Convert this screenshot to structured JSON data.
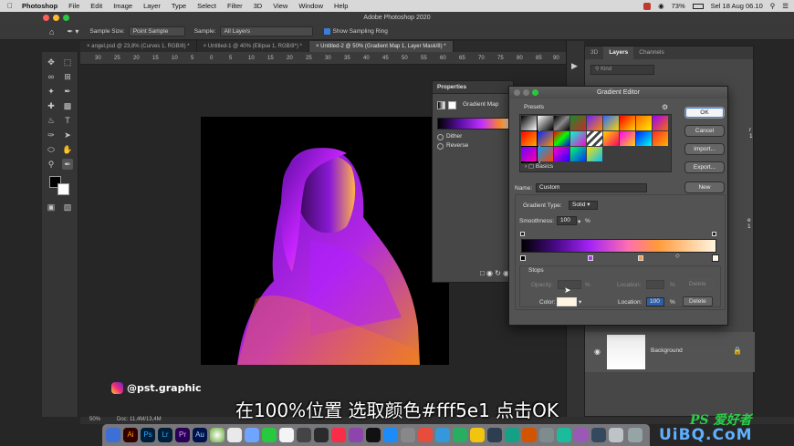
{
  "menubar": {
    "app": "Photoshop",
    "items": [
      "File",
      "Edit",
      "Image",
      "Layer",
      "Type",
      "Select",
      "Filter",
      "3D",
      "View",
      "Window",
      "Help"
    ],
    "battery": "73%",
    "clock": "Sel 18 Aug  06.10"
  },
  "window": {
    "title": "Adobe Photoshop 2020"
  },
  "options": {
    "sample_size_label": "Sample Size:",
    "sample_size_value": "Point Sample",
    "sample_label": "Sample:",
    "sample_value": "All Layers",
    "show_ring_label": "Show Sampling Ring"
  },
  "tabs": [
    {
      "label": "angel.psd @ 23,8% (Curves 1, RGB/8) *"
    },
    {
      "label": "Untitled-1 @ 40% (Ellipse 1, RGB/8*) *"
    },
    {
      "label": "Untitled-2 @ 50% (Gradient Map 1, Layer Mask/8) *"
    }
  ],
  "ruler": [
    "30",
    "25",
    "20",
    "15",
    "10",
    "5",
    "0",
    "5",
    "10",
    "15",
    "20",
    "25",
    "30",
    "35",
    "40",
    "45",
    "50",
    "55",
    "60",
    "65",
    "70",
    "75",
    "80",
    "85",
    "90"
  ],
  "properties": {
    "title": "Properties",
    "layer_name": "Gradient Map",
    "dither_label": "Dither",
    "reverse_label": "Reverse"
  },
  "gradient_editor": {
    "title": "Gradient Editor",
    "presets_label": "Presets",
    "basics_label": "Basics",
    "name_label": "Name:",
    "name_value": "Custom",
    "type_label": "Gradient Type:",
    "type_value": "Solid",
    "smoothness_label": "Smoothness:",
    "smoothness_value": "100",
    "percent": "%",
    "stops_label": "Stops",
    "opacity_label": "Opacity:",
    "opacity_location_label": "Location:",
    "delete_label": "Delete",
    "color_label": "Color:",
    "location_label": "Location:",
    "location_value": "100",
    "buttons": {
      "ok": "OK",
      "cancel": "Cancel",
      "import": "Import...",
      "export": "Export...",
      "new": "New"
    },
    "stop_color": "#fff5e1"
  },
  "layers": {
    "tabs": [
      "3D",
      "Layers",
      "Channels"
    ],
    "kind_placeholder": "Kind",
    "background_label": "Background",
    "partial_labels": [
      "r 1",
      "e 1"
    ]
  },
  "status": {
    "zoom": "50%",
    "doc": "Doc: 11,4M/13,4M"
  },
  "watermark": {
    "handle": "@pst.graphic"
  },
  "subtitle": "在100%位置 选取颜色#fff5e1 点击OK",
  "brand": {
    "text": "PS 爱好者",
    "site": "UiBQ.CoM"
  }
}
